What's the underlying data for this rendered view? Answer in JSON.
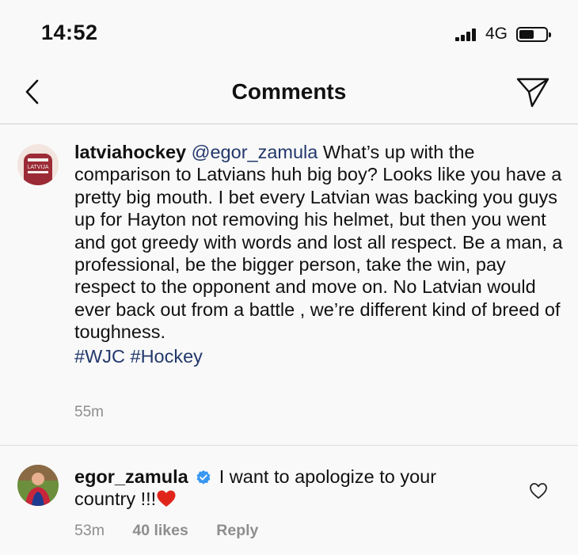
{
  "status_bar": {
    "time": "14:52",
    "network": "4G",
    "signal_bars": 4
  },
  "nav": {
    "title": "Comments",
    "back_icon": "chevron-left-icon",
    "send_icon": "paper-plane-icon"
  },
  "comments": [
    {
      "username": "latviahockey",
      "mention": "@egor_zamula",
      "body": "What’s up with the comparison to Latvians huh big boy?  Looks like you have a pretty big mouth. I bet every Latvian was backing you guys up for Hayton not removing his helmet, but then you went and got greedy with words and lost all respect. Be a man, a professional, be the bigger person, take the win, pay respect to the opponent and move on. No Latvian would ever back out from a battle , we’re different kind of breed of toughness.",
      "hashtags": "#WJC #Hockey",
      "time_ago": "55m",
      "avatar_text": "LATVIJA"
    },
    {
      "username": "egor_zamula",
      "verified": true,
      "body": "I want to apologize to your country !!!",
      "emoji": "red-heart-emoji",
      "time_ago": "53m",
      "likes": "40 likes",
      "reply_label": "Reply",
      "like_icon": "heart-outline-icon"
    }
  ],
  "colors": {
    "background": "#f9f9f9",
    "link": "#22386b",
    "verified": "#3897f0",
    "muted": "#8e8e8e",
    "heart": "#e0261b"
  }
}
